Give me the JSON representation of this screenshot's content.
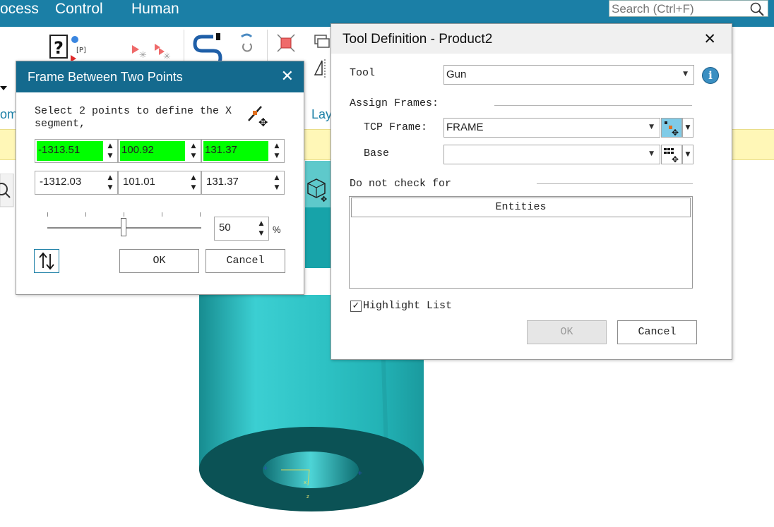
{
  "menubar": {
    "items": [
      "ocess",
      "Control",
      "Human"
    ],
    "search_placeholder": "Search (Ctrl+F)"
  },
  "ribbon": {
    "labels": [
      "om",
      "Lay"
    ]
  },
  "frame_dialog": {
    "title": "Frame Between Two Points",
    "instruction": "Select 2 points to define the X segment,",
    "point1": [
      "-1313.51",
      "100.92",
      "131.37"
    ],
    "point2": [
      "-1312.03",
      "101.01",
      "131.37"
    ],
    "ratio_value": "50",
    "ratio_unit": "%",
    "ok_label": "OK",
    "cancel_label": "Cancel"
  },
  "tool_dialog": {
    "title": "Tool Definition - Product2",
    "tool_label": "Tool",
    "tool_value": "Gun",
    "assign_frames_label": "Assign Frames:",
    "tcp_frame_label": "TCP Frame:",
    "tcp_frame_value": "FRAME",
    "base_label": "Base",
    "base_value": "",
    "do_not_check_label": "Do not check for",
    "entities_header": "Entities",
    "highlight_list_label": "Highlight List",
    "highlight_list_checked": true,
    "ok_label": "OK",
    "cancel_label": "Cancel"
  },
  "colors": {
    "menubar": "#1b7fa6",
    "frame_title_bar": "#146a8e",
    "valid_field": "#00ff00",
    "model_teal": "#2ec2c4",
    "yellow_band": "#fff7b7"
  }
}
